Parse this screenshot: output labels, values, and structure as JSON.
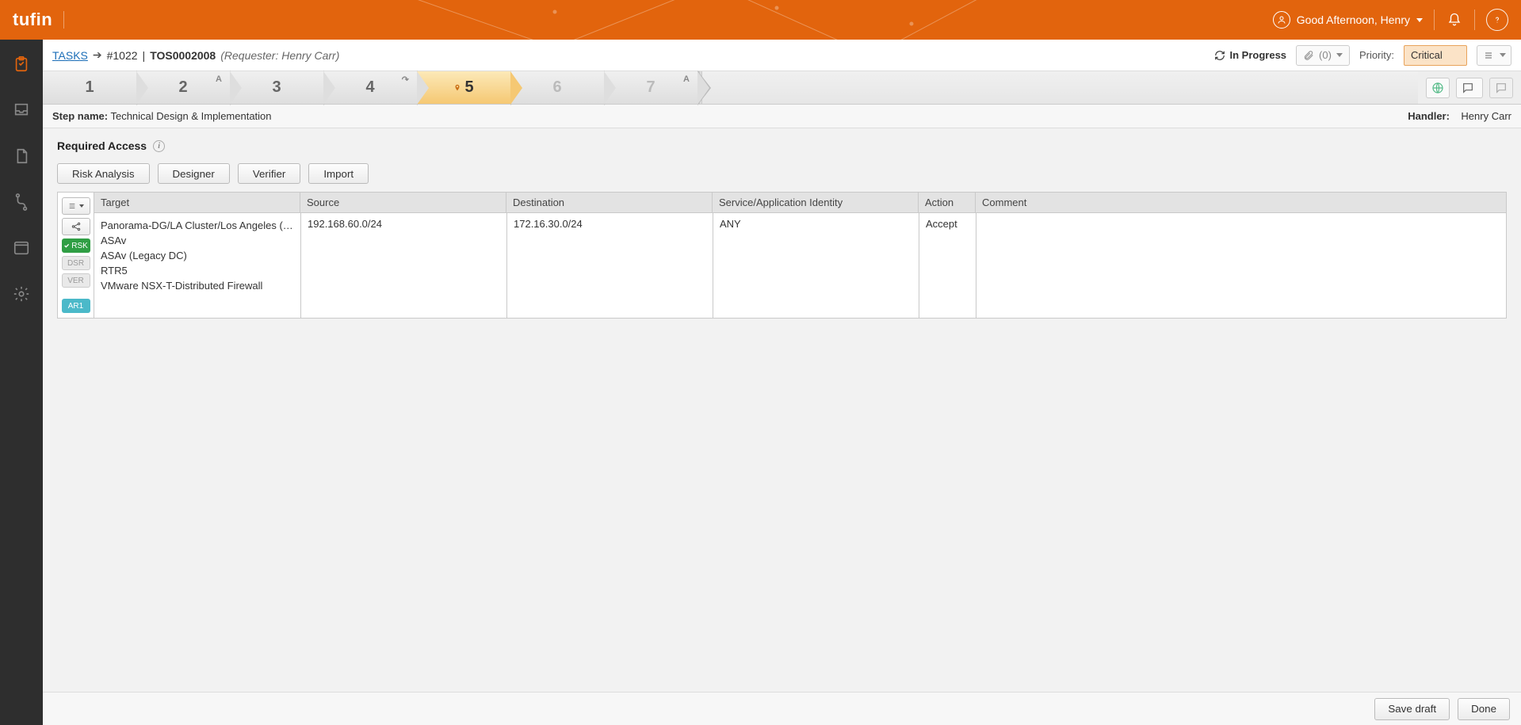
{
  "brand": {
    "name": "tufin"
  },
  "user": {
    "greeting": "Good Afternoon, Henry"
  },
  "breadcrumb": {
    "tasks_label": "TASKS",
    "ticket_hash": "#1022",
    "pipe": "|",
    "tos_id": "TOS0002008",
    "requester": "(Requester: Henry Carr)"
  },
  "status": {
    "text": "In Progress"
  },
  "attachments": {
    "count_label": "(0)"
  },
  "priority": {
    "label": "Priority:",
    "value": "Critical"
  },
  "steps": {
    "items": [
      {
        "num": "1",
        "badge": ""
      },
      {
        "num": "2",
        "badge": "A"
      },
      {
        "num": "3",
        "badge": ""
      },
      {
        "num": "4",
        "badge": "↷"
      },
      {
        "num": "5",
        "badge": "",
        "active": true,
        "locator": true
      },
      {
        "num": "6",
        "badge": "",
        "disabled": true
      },
      {
        "num": "7",
        "badge": "A",
        "disabled": true
      }
    ]
  },
  "step_info": {
    "name_label": "Step name:",
    "name_value": "Technical Design & Implementation",
    "handler_label": "Handler:",
    "handler_value": "Henry Carr"
  },
  "section": {
    "title": "Required Access"
  },
  "toolbar": {
    "risk": "Risk Analysis",
    "designer": "Designer",
    "verifier": "Verifier",
    "import": "Import"
  },
  "badges": {
    "rsk": "RSK",
    "dsr": "DSR",
    "ver": "VER",
    "ar1": "AR1"
  },
  "table": {
    "headers": {
      "target": "Target",
      "source": "Source",
      "destination": "Destination",
      "service": "Service/Application Identity",
      "action": "Action",
      "comment": "Comment"
    },
    "row": {
      "targets": [
        "Panorama-DG/LA Cluster/Los Angeles (PAN Clus...",
        "ASAv",
        "ASAv (Legacy DC)",
        "RTR5",
        "VMware NSX-T-Distributed Firewall"
      ],
      "source": "192.168.60.0/24",
      "destination": "172.16.30.0/24",
      "service": "ANY",
      "action": "Accept",
      "comment": ""
    }
  },
  "footer": {
    "save": "Save draft",
    "done": "Done"
  }
}
